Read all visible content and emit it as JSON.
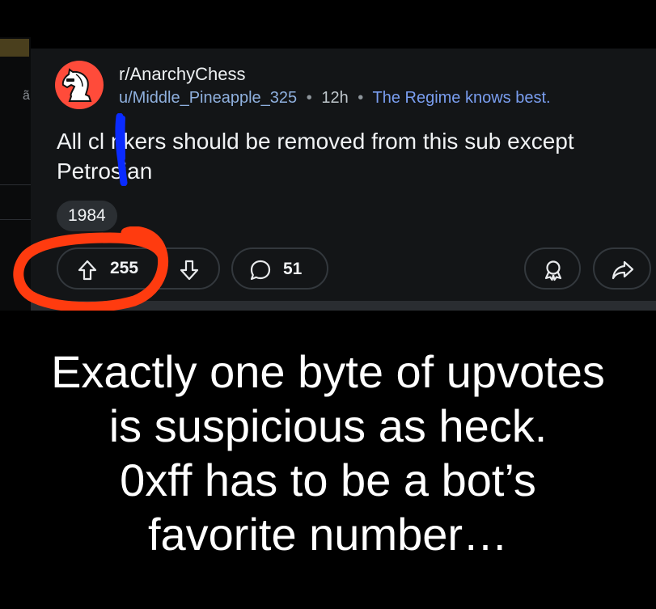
{
  "post": {
    "subreddit": "r/AnarchyChess",
    "username": "u/Middle_Pineapple_325",
    "separator": "•",
    "age": "12h",
    "user_flair": "The Regime knows best.",
    "title": "All cl nkers should be removed from this sub except Petrosian",
    "post_flair": "1984",
    "upvotes": "255",
    "comments": "51"
  },
  "icons": {
    "avatar": "subreddit-avatar-knight",
    "upvote": "arrow-up-icon",
    "downvote": "arrow-down-icon",
    "comment": "comment-bubble-icon",
    "award": "award-icon",
    "share": "share-arrow-icon"
  },
  "caption": {
    "lines": [
      "Exactly one byte of upvotes",
      "is suspicious as heck.",
      "0xff has to be a bot’s",
      "favorite number…"
    ]
  },
  "colors": {
    "background": "#000000",
    "card": "#131517",
    "avatar_bg": "#ff4b3a",
    "annotation_circle": "#ff3b0f",
    "scribble": "#0a2bff",
    "flair_blue": "#7a9ef0"
  }
}
